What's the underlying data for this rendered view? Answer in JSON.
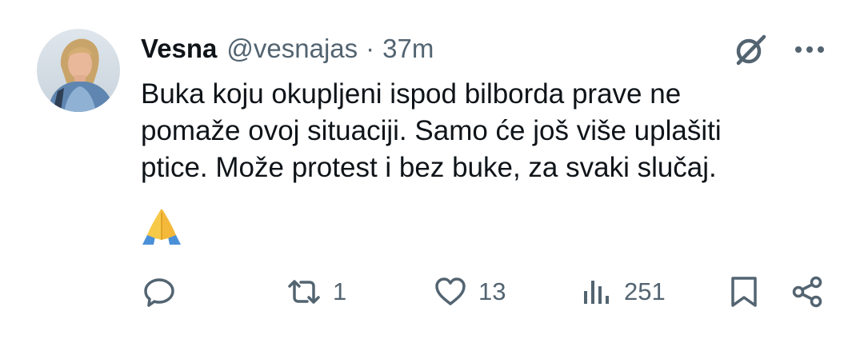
{
  "tweet": {
    "author": {
      "display_name": "Vesna",
      "handle": "@vesnajas",
      "separator": "·",
      "timestamp": "37m",
      "avatar": "profile-photo"
    },
    "text": "Buka koju okupljeni ispod bilborda prave ne\npomaže ovoj situaciji. Samo će još više uplašiti\nptice. Može protest i bez buke, za svaki slučaj.",
    "emoji": "🙏",
    "emoji_icon": "folded-hands-emoji",
    "actions": {
      "reply": {
        "icon": "reply-icon",
        "count": ""
      },
      "retweet": {
        "icon": "retweet-icon",
        "count": "1"
      },
      "like": {
        "icon": "heart-icon",
        "count": "13"
      },
      "views": {
        "icon": "views-icon",
        "count": "251"
      },
      "bookmark": {
        "icon": "bookmark-icon"
      },
      "share": {
        "icon": "share-icon"
      }
    },
    "header_icons": [
      "grok-icon",
      "more-icon"
    ]
  },
  "colors": {
    "text_primary": "#0f1419",
    "text_secondary": "#536471",
    "background": "#ffffff"
  }
}
